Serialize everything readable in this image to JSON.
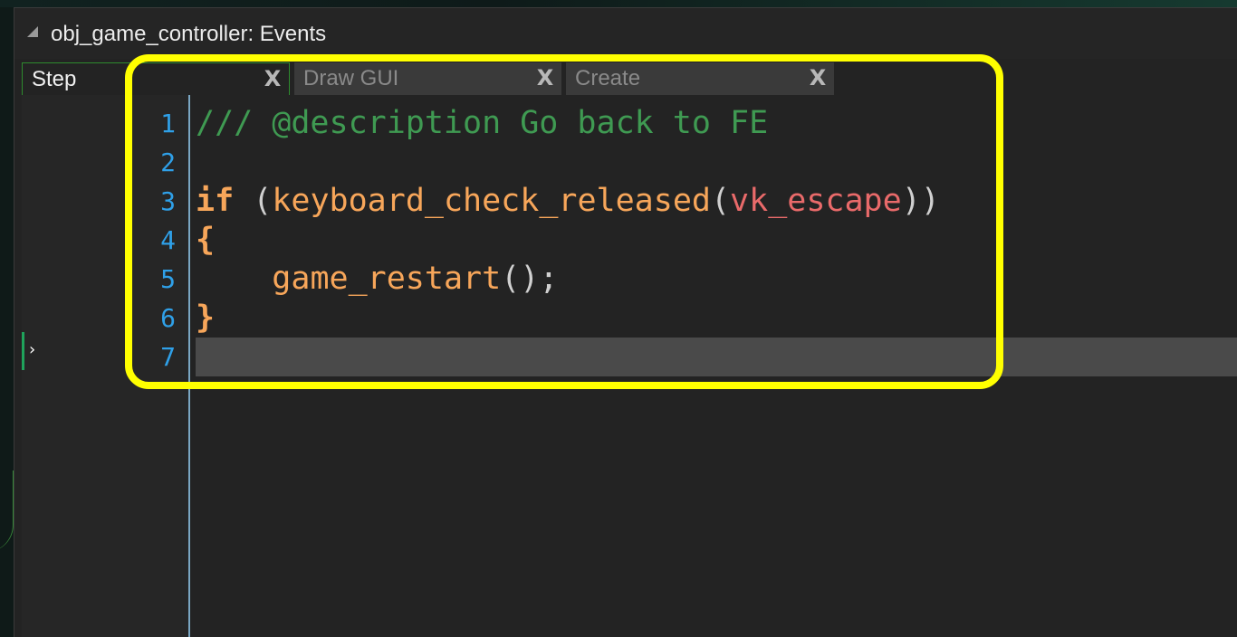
{
  "window": {
    "title": "obj_game_controller: Events"
  },
  "tabs": [
    {
      "label": "Step",
      "active": true,
      "close_icon": "x-close-icon"
    },
    {
      "label": "Draw GUI",
      "active": false,
      "close_icon": "x-close-icon"
    },
    {
      "label": "Create",
      "active": false,
      "close_icon": "x-close-icon"
    }
  ],
  "close_glyph": "X",
  "gutter_arrow": "›",
  "editor": {
    "line_numbers": [
      "1",
      "2",
      "3",
      "4",
      "5",
      "6",
      "7"
    ],
    "current_line": 7,
    "lines": [
      {
        "tokens": [
          {
            "t": "/// @description Go back to FE",
            "k": "comment"
          }
        ]
      },
      {
        "tokens": []
      },
      {
        "tokens": [
          {
            "t": "if",
            "k": "kw"
          },
          {
            "t": " (",
            "k": "punc"
          },
          {
            "t": "keyboard_check_released",
            "k": "func"
          },
          {
            "t": "(",
            "k": "punc"
          },
          {
            "t": "vk_escape",
            "k": "const"
          },
          {
            "t": "))",
            "k": "punc"
          }
        ]
      },
      {
        "tokens": [
          {
            "t": "{",
            "k": "brace"
          }
        ]
      },
      {
        "tokens": [
          {
            "t": "    ",
            "k": "punc"
          },
          {
            "t": "game_restart",
            "k": "func"
          },
          {
            "t": "();",
            "k": "punc"
          }
        ]
      },
      {
        "tokens": [
          {
            "t": "}",
            "k": "brace"
          }
        ]
      },
      {
        "tokens": []
      }
    ]
  },
  "colors": {
    "comment": "#3f9a52",
    "keyword": "#f7a65a",
    "constant": "#e96a6a",
    "line_number": "#2fa0e8",
    "highlight": "#ffff00",
    "active_tab_border": "#2e8b2e"
  }
}
